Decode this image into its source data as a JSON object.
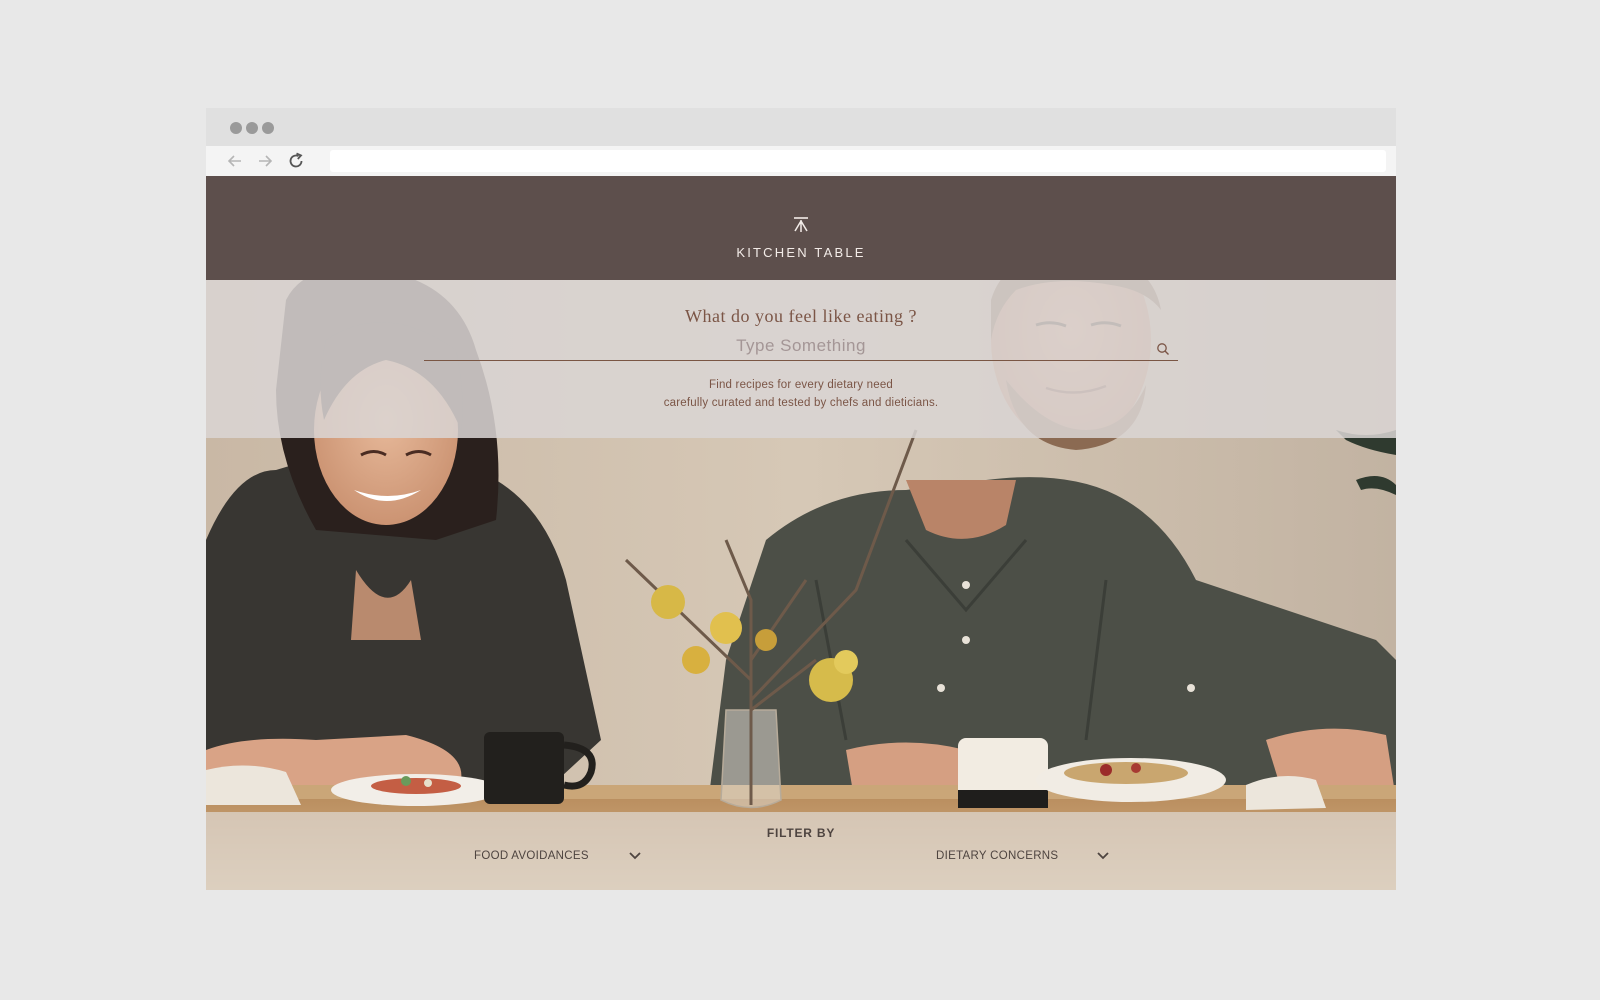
{
  "brand": {
    "name": "KITCHEN TABLE",
    "logo_icon": "kitchen-table-logo-icon"
  },
  "search": {
    "heading": "What do you feel like eating ?",
    "placeholder": "Type Something",
    "value": "",
    "icon": "search-icon"
  },
  "tagline": {
    "line1": "Find recipes for every dietary need",
    "line2": "carefully curated and tested by chefs and dieticians."
  },
  "filters": {
    "title": "FILTER BY",
    "options": [
      {
        "label": "FOOD AVOIDANCES"
      },
      {
        "label": "DIETARY CONCERNS"
      }
    ]
  },
  "colors": {
    "header_bg": "#5d4f4c",
    "accent": "#7b5546",
    "page_bg": "#e8e8e8"
  }
}
